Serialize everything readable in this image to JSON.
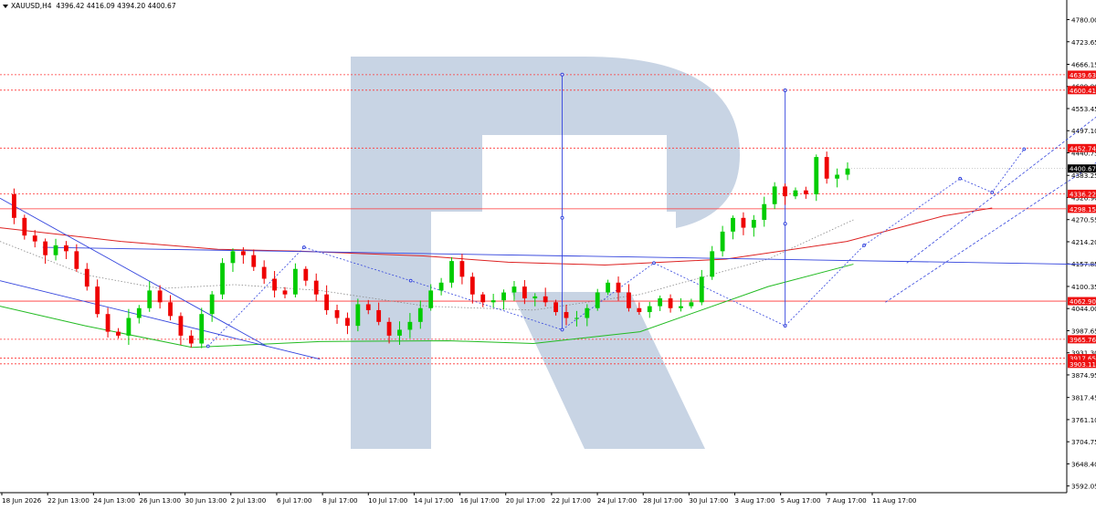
{
  "header": {
    "symbol": "XAUUSD,H4",
    "ohlc": "4396.42 4416.09 4394.20 4400.67"
  },
  "colors": {
    "bull": "#00cc00",
    "bear": "#ee0000",
    "level_line": "#ff3333",
    "level_badge": "#ee1111",
    "current_badge": "#000000",
    "blue_line": "#3344dd",
    "ma_red": "#dd2222",
    "ma_green": "#22bb22",
    "watermark": "#c8d4e4"
  },
  "chart_data": {
    "type": "candlestick",
    "symbol": "XAUUSD",
    "timeframe": "H4",
    "last_bar": {
      "open": 4396.42,
      "high": 4416.09,
      "low": 4394.2,
      "close": 4400.67
    },
    "ylim": [
      3575,
      4830
    ],
    "y_ticks": [
      "4780.00",
      "4723.65",
      "4666.15",
      "4609.80",
      "4553.45",
      "4497.10",
      "4440.75",
      "4383.25",
      "4326.90",
      "4270.55",
      "4214.20",
      "4157.85",
      "4100.35",
      "4044.00",
      "3987.65",
      "3931.30",
      "3874.95",
      "3817.45",
      "3761.10",
      "3704.75",
      "3648.40",
      "3592.05"
    ],
    "x_ticks": [
      "18 Jun 2026",
      "22 Jun 13:00",
      "24 Jun 13:00",
      "26 Jun 13:00",
      "30 Jun 13:00",
      "2 Jul 13:00",
      "6 Jul 17:00",
      "8 Jul 17:00",
      "10 Jul 17:00",
      "14 Jul 17:00",
      "16 Jul 17:00",
      "20 Jul 17:00",
      "22 Jul 17:00",
      "24 Jul 17:00",
      "28 Jul 17:00",
      "30 Jul 17:00",
      "3 Aug 17:00",
      "5 Aug 17:00",
      "7 Aug 17:00",
      "11 Aug 17:00"
    ],
    "current_price": "4400.67",
    "levels": [
      "4639.63",
      "4600.41",
      "4452.74",
      "4336.22",
      "4298.15",
      "4062.90",
      "3965.76",
      "3917.65",
      "3903.11"
    ],
    "close_path": [
      4335,
      4275,
      4230,
      4215,
      4180,
      4205,
      4190,
      4145,
      4100,
      4030,
      3985,
      3975,
      4020,
      4045,
      4090,
      4060,
      4025,
      3975,
      3955,
      4030,
      4080,
      4160,
      4190,
      4180,
      4150,
      4120,
      4090,
      4080,
      4145,
      4115,
      4080,
      4040,
      4020,
      4000,
      4055,
      4040,
      4010,
      3975,
      3990,
      4010,
      4045,
      4090,
      4110,
      4165,
      4125,
      4080,
      4060,
      4065,
      4085,
      4100,
      4070,
      4075,
      4060,
      4035,
      4020,
      4020,
      4045,
      4085,
      4110,
      4085,
      4045,
      4035,
      4050,
      4070,
      4045,
      4050,
      4060,
      4125,
      4190,
      4240,
      4275,
      4250,
      4270,
      4310,
      4355,
      4330,
      4345,
      4335,
      4430,
      4375,
      4385,
      4405
    ],
    "ma_red": [
      [
        0,
        4250
      ],
      [
        0.1,
        4215
      ],
      [
        0.18,
        4195
      ],
      [
        0.25,
        4190
      ],
      [
        0.35,
        4178
      ],
      [
        0.42,
        4162
      ],
      [
        0.5,
        4155
      ],
      [
        0.6,
        4170
      ],
      [
        0.7,
        4215
      ],
      [
        0.78,
        4280
      ],
      [
        0.82,
        4300
      ]
    ],
    "ma_green": [
      [
        0,
        4050
      ],
      [
        0.08,
        4000
      ],
      [
        0.18,
        3945
      ],
      [
        0.3,
        3960
      ],
      [
        0.42,
        3962
      ],
      [
        0.5,
        3955
      ],
      [
        0.6,
        3985
      ],
      [
        0.72,
        4100
      ],
      [
        0.8,
        4157
      ]
    ],
    "ma_dotted": [
      [
        0,
        4215
      ],
      [
        0.08,
        4130
      ],
      [
        0.15,
        4095
      ],
      [
        0.22,
        4105
      ],
      [
        0.3,
        4090
      ],
      [
        0.4,
        4050
      ],
      [
        0.5,
        4040
      ],
      [
        0.6,
        4080
      ],
      [
        0.72,
        4170
      ],
      [
        0.8,
        4270
      ]
    ],
    "trendlines": {
      "solid": [
        [
          [
            0,
            4115
          ],
          [
            0.3,
            3915
          ]
        ],
        [
          [
            0,
            4325
          ],
          [
            0.25,
            3948
          ]
        ],
        [
          [
            0.04,
            4200
          ],
          [
            1.05,
            4155
          ]
        ]
      ],
      "vertical": [
        [
          0.527,
          3990,
          4640
        ],
        [
          0.736,
          4000,
          4600
        ]
      ],
      "zigzag": [
        [
          0.195,
          3948
        ],
        [
          0.285,
          4200
        ],
        [
          0.385,
          4115
        ],
        [
          0.527,
          3990
        ],
        [
          0.613,
          4160
        ],
        [
          0.736,
          4000
        ],
        [
          0.81,
          4205
        ],
        [
          0.9,
          4375
        ],
        [
          0.93,
          4340
        ],
        [
          0.96,
          4450
        ]
      ],
      "channel_upper": [
        [
          0.85,
          4160
        ],
        [
          1.06,
          4600
        ]
      ],
      "channel_lower": [
        [
          0.83,
          4060
        ],
        [
          1.13,
          4600
        ]
      ]
    }
  }
}
